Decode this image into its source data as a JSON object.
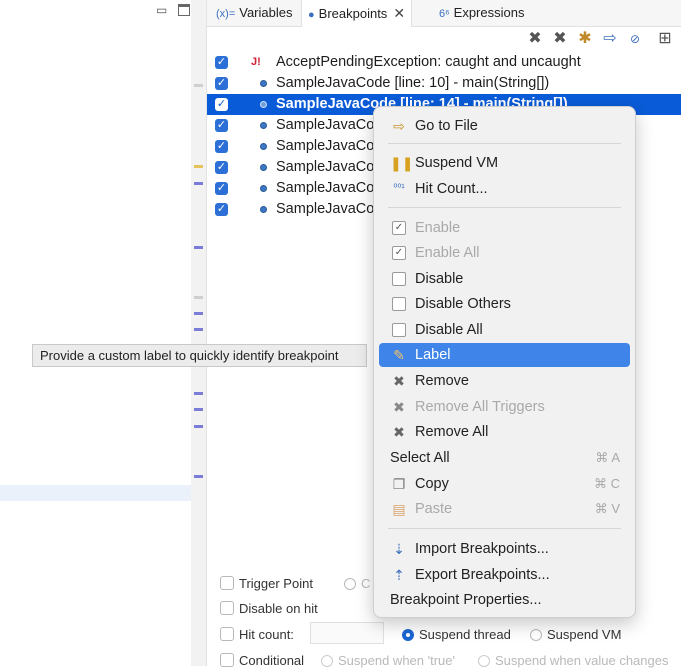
{
  "tabs": [
    {
      "label": "Variables",
      "icon_text": "(x)="
    },
    {
      "label": "Breakpoints",
      "icon": "breakpoints-icon",
      "close": "✕"
    },
    {
      "label": "Expressions",
      "icon_text": "6⁶"
    }
  ],
  "toolbar": {
    "icons": [
      "remove-breakpoint-icon",
      "remove-all-breakpoints-icon",
      "show-supported-icon",
      "go-to-file-icon",
      "skip-breakpoints-icon",
      "view-menu-icon"
    ]
  },
  "breakpoints": [
    {
      "label": "AcceptPendingException: caught and uncaught",
      "checked": true,
      "type": "exception"
    },
    {
      "label": "SampleJavaCode [line: 10] - main(String[])",
      "checked": true,
      "type": "line"
    },
    {
      "label": "SampleJavaCode [line: 14] - main(String[])",
      "checked": true,
      "type": "line",
      "selected": true
    },
    {
      "label": "SampleJavaCo",
      "checked": true,
      "type": "line"
    },
    {
      "label": "SampleJavaCo",
      "checked": true,
      "type": "line"
    },
    {
      "label": "SampleJavaCo",
      "checked": true,
      "type": "line"
    },
    {
      "label": "SampleJavaCo",
      "checked": true,
      "type": "line"
    },
    {
      "label": "SampleJavaCo",
      "checked": true,
      "type": "line"
    }
  ],
  "tooltip": "Provide a custom label to quickly identify breakpoint",
  "settings": {
    "trigger_point": "Trigger Point",
    "trigger_radio": "C",
    "disable_on_hit": "Disable on hit",
    "hit_count": "Hit count:",
    "suspend_thread": "Suspend thread",
    "suspend_vm": "Suspend VM",
    "conditional": "Conditional",
    "suspend_when_true": "Suspend when 'true'",
    "suspend_when_changes": "Suspend when value changes"
  },
  "menu": {
    "go_to_file": "Go to File",
    "suspend_vm": "Suspend VM",
    "hit_count": "Hit Count...",
    "enable": "Enable",
    "enable_all": "Enable All",
    "disable": "Disable",
    "disable_others": "Disable Others",
    "disable_all": "Disable All",
    "label": "Label",
    "remove": "Remove",
    "remove_all_triggers": "Remove All Triggers",
    "remove_all": "Remove All",
    "select_all": "Select All",
    "select_all_shortcut": "⌘ A",
    "copy": "Copy",
    "copy_shortcut": "⌘ C",
    "paste": "Paste",
    "paste_shortcut": "⌘ V",
    "import": "Import Breakpoints...",
    "export": "Export Breakpoints...",
    "properties": "Breakpoint Properties..."
  },
  "colors": {
    "selection": "#0a5bd8",
    "menu_highlight": "#3f84e8",
    "checkbox": "#2c6fd6"
  }
}
